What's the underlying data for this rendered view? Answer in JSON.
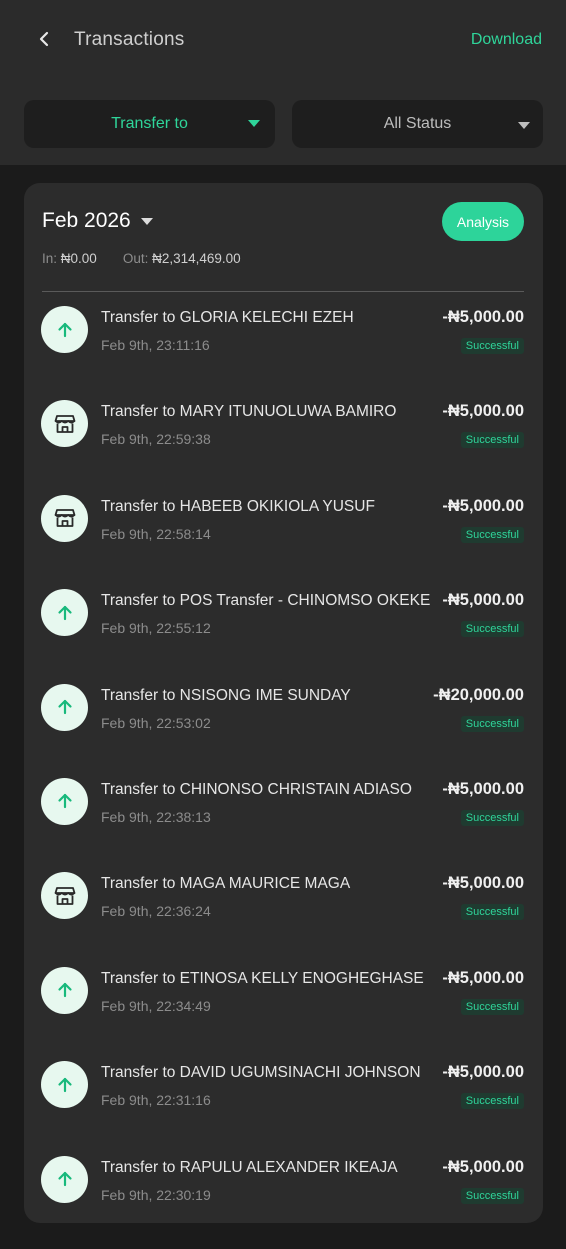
{
  "header": {
    "title": "Transactions",
    "download_label": "Download",
    "back_icon": "chevron-left-icon"
  },
  "filters": {
    "type_filter": "Transfer to",
    "status_filter": "All Status"
  },
  "colors": {
    "accent": "#2fd59a",
    "background": "#1b1b1b",
    "card": "#2c2c2c"
  },
  "summary": {
    "month": "Feb 2026",
    "analysis_label": "Analysis",
    "in_label": "In:",
    "in_value": "₦0.00",
    "out_label": "Out:",
    "out_value": "₦2,314,469.00"
  },
  "transactions": [
    {
      "name": "Transfer to GLORIA KELECHI EZEH",
      "time": "Feb 9th, 23:11:16",
      "amount": "-₦5,000.00",
      "status": "Successful",
      "icon": "arrow-up-icon"
    },
    {
      "name": "Transfer to MARY ITUNUOLUWA BAMIRO",
      "time": "Feb 9th, 22:59:38",
      "amount": "-₦5,000.00",
      "status": "Successful",
      "icon": "store-icon"
    },
    {
      "name": "Transfer to HABEEB OKIKIOLA YUSUF",
      "time": "Feb 9th, 22:58:14",
      "amount": "-₦5,000.00",
      "status": "Successful",
      "icon": "store-icon"
    },
    {
      "name": "Transfer to POS Transfer - CHINOMSO OKEKE",
      "time": "Feb 9th, 22:55:12",
      "amount": "-₦5,000.00",
      "status": "Successful",
      "icon": "arrow-up-icon"
    },
    {
      "name": "Transfer to NSISONG IME SUNDAY",
      "time": "Feb 9th, 22:53:02",
      "amount": "-₦20,000.00",
      "status": "Successful",
      "icon": "arrow-up-icon"
    },
    {
      "name": "Transfer to CHINONSO CHRISTAIN ADIASO",
      "time": "Feb 9th, 22:38:13",
      "amount": "-₦5,000.00",
      "status": "Successful",
      "icon": "arrow-up-icon"
    },
    {
      "name": "Transfer to MAGA MAURICE MAGA",
      "time": "Feb 9th, 22:36:24",
      "amount": "-₦5,000.00",
      "status": "Successful",
      "icon": "store-icon"
    },
    {
      "name": "Transfer to ETINOSA KELLY ENOGHEGHASE",
      "time": "Feb 9th, 22:34:49",
      "amount": "-₦5,000.00",
      "status": "Successful",
      "icon": "arrow-up-icon"
    },
    {
      "name": "Transfer to DAVID UGUMSINACHI JOHNSON",
      "time": "Feb 9th, 22:31:16",
      "amount": "-₦5,000.00",
      "status": "Successful",
      "icon": "arrow-up-icon"
    },
    {
      "name": "Transfer to RAPULU ALEXANDER IKEAJA",
      "time": "Feb 9th, 22:30:19",
      "amount": "-₦5,000.00",
      "status": "Successful",
      "icon": "arrow-up-icon"
    }
  ]
}
